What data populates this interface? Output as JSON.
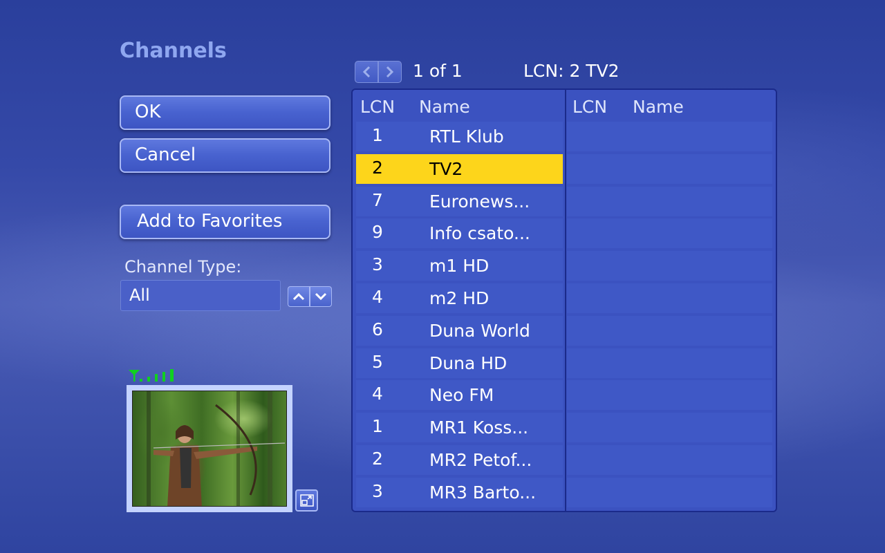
{
  "title": "Channels",
  "buttons": {
    "ok": "OK",
    "cancel": "Cancel",
    "add_favorites": "Add to Favorites"
  },
  "channel_type": {
    "label": "Channel Type:",
    "value": "All"
  },
  "pager": {
    "page_text": "1 of 1",
    "lcn_text": "LCN: 2 TV2"
  },
  "table": {
    "left_headers": [
      "LCN",
      "Name"
    ],
    "right_headers": [
      "LCN",
      "Name"
    ],
    "rows": [
      {
        "lcn": "1",
        "name": "RTL Klub",
        "selected": false
      },
      {
        "lcn": "2",
        "name": "TV2",
        "selected": true
      },
      {
        "lcn": "7",
        "name": "Euronews...",
        "selected": false
      },
      {
        "lcn": "9",
        "name": "Info csato...",
        "selected": false
      },
      {
        "lcn": "3",
        "name": "m1 HD",
        "selected": false
      },
      {
        "lcn": "4",
        "name": "m2 HD",
        "selected": false
      },
      {
        "lcn": "6",
        "name": "Duna World",
        "selected": false
      },
      {
        "lcn": "5",
        "name": "Duna HD",
        "selected": false
      },
      {
        "lcn": "4",
        "name": "Neo FM",
        "selected": false
      },
      {
        "lcn": "1",
        "name": "MR1 Koss...",
        "selected": false
      },
      {
        "lcn": "2",
        "name": "MR2 Petof...",
        "selected": false
      },
      {
        "lcn": "3",
        "name": "MR3 Barto...",
        "selected": false
      }
    ]
  },
  "signal": {
    "bars": 5,
    "color": "#10d020"
  },
  "colors": {
    "selected_row": "#fdd51b",
    "title": "#8fa7f0"
  },
  "icons": [
    "antenna-icon",
    "chevron-left-icon",
    "chevron-right-icon",
    "chevron-up-icon",
    "chevron-down-icon",
    "expand-icon"
  ]
}
